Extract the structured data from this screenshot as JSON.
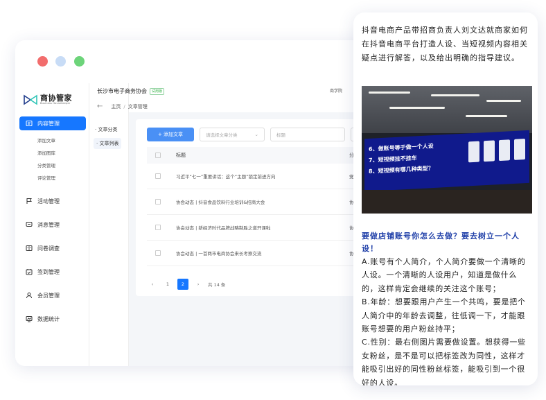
{
  "window": {
    "logo": {
      "title": "商协管家",
      "subtitle": "Business Housekeeper"
    },
    "org": {
      "name": "长沙市电子商务协会",
      "badge": "试用版"
    },
    "top_right": "商学院",
    "breadcrumb": {
      "home": "主页",
      "current": "文章管理"
    },
    "sidebar": {
      "active": "内容管理",
      "sub_items": [
        "添加文章",
        "添加图库",
        "分类管理",
        "评论管理"
      ],
      "items": [
        "活动管理",
        "消息管理",
        "问卷调查",
        "签到管理",
        "会员管理",
        "数据统计"
      ]
    },
    "col2": {
      "items": [
        "文章分类",
        "文章列表"
      ]
    },
    "toolbar": {
      "add_label": "添加文章",
      "category_placeholder": "请选择文章分类",
      "title_placeholder": "标题"
    },
    "table": {
      "headers": {
        "title": "标题",
        "category": "分"
      },
      "rows": [
        {
          "title": "习近平“七一”重要讲话：这个“主题”锁定前进方向",
          "category": "党"
        },
        {
          "title": "协会动态 | 抖音食品饮料行业培训&招商大会",
          "category": "协"
        },
        {
          "title": "协会动态 | 新经济时代品牌战略制胜之道开课啦",
          "category": "协"
        },
        {
          "title": "协会动态 | 一首两市电商协会来长考察交流",
          "category": "协"
        }
      ]
    },
    "pager": {
      "prev": "‹",
      "pages": [
        "1",
        "2"
      ],
      "current": "2",
      "next": "›",
      "total": "共 14 条"
    }
  },
  "panel": {
    "intro": "抖音电商产品带招商负责人刘文达就商家如何在抖音电商平台打造人设、当短视频内容相关疑点进行解答，以及给出明确的指导建议。",
    "photo_lines": [
      "6、做账号等于做一个人设",
      "7、短视频挂不挂车",
      "8、短视频有哪几种类型？"
    ],
    "heading": "要做店铺账号你怎么去做？要去树立一个人设！",
    "body": [
      "A.账号有个人简介，个人简介要做一个清晰的人设。一个清晰的人设用户，知道是做什么的，这样肯定会继续的关注这个账号；",
      "B.年龄：想要跟用户产生一个共鸣，要是把个人简介中的年龄去调整，往低调一下，才能跟账号想要的用户粉丝持平；",
      "C.性别：最右侧图片需要做设置。想获得一些女粉丝，是不是可以把标签改为同性，这样才能吸引出好的同性粉丝标签，能吸引到一个很好的人设。"
    ]
  }
}
